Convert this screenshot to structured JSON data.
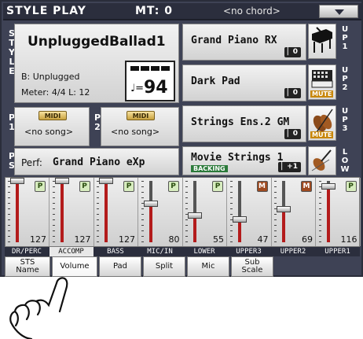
{
  "topbar": {
    "mode": "STYLE PLAY",
    "mt": "MT: 0",
    "chord": "<no chord>"
  },
  "style": {
    "side_label": "S T Y L E",
    "name": "UnpluggedBallad1",
    "bank": "B: Unplugged",
    "meter": "Meter: 4/4  L: 12",
    "tempo_note": "♩=",
    "tempo": "94"
  },
  "players": [
    {
      "id": "P\n1",
      "tag": "MIDI",
      "song": "<no song>"
    },
    {
      "id": "P\n2",
      "tag": "MIDI",
      "song": "<no song>"
    }
  ],
  "performance": {
    "side_label": "P S",
    "text": "Perf:",
    "name": "Grand Piano eXp"
  },
  "sounds": [
    {
      "name": "Grand Piano RX",
      "badge": "▏0",
      "side": "U P 1",
      "icon": "piano-icon",
      "mute": ""
    },
    {
      "name": "Dark Pad",
      "badge": "▏0",
      "side": "U P 2",
      "icon": "synth-icon",
      "mute": "MUTE"
    },
    {
      "name": "Strings Ens.2 GM",
      "badge": "▏0",
      "side": "U P 3",
      "icon": "strings-icon",
      "mute": "MUTE"
    },
    {
      "name": "Movie Strings 1",
      "badge": "▏+1",
      "side": "L O W",
      "icon": "violin-icon",
      "mute": "",
      "backing": "BACKING"
    }
  ],
  "mixer": {
    "channels": [
      {
        "label": "DR/PERC",
        "value": 127,
        "level": 1.0,
        "state": "P"
      },
      {
        "label": "ACCOMP",
        "value": 127,
        "level": 1.0,
        "state": "P"
      },
      {
        "label": "BASS",
        "value": 127,
        "level": 1.0,
        "state": "P"
      },
      {
        "label": "MIC/IN",
        "value": 80,
        "level": 0.63,
        "state": "P"
      },
      {
        "label": "LOWER",
        "value": 55,
        "level": 0.43,
        "state": "P"
      },
      {
        "label": "UPPER3",
        "value": 47,
        "level": 0.37,
        "state": "M"
      },
      {
        "label": "UPPER2",
        "value": 69,
        "level": 0.54,
        "state": "M"
      },
      {
        "label": "UPPER1",
        "value": 116,
        "level": 0.91,
        "state": "P"
      }
    ]
  },
  "tabs": [
    {
      "label": "STS Name"
    },
    {
      "label": "Volume"
    },
    {
      "label": "Pad"
    },
    {
      "label": "Split"
    },
    {
      "label": "Mic"
    },
    {
      "label": "Sub Scale"
    }
  ],
  "colors": {
    "screen_bg": "#3e4255",
    "header_bg": "#2b2e3d",
    "fader_red": "#b31b1b",
    "mute_brown": "#9e4a20"
  }
}
